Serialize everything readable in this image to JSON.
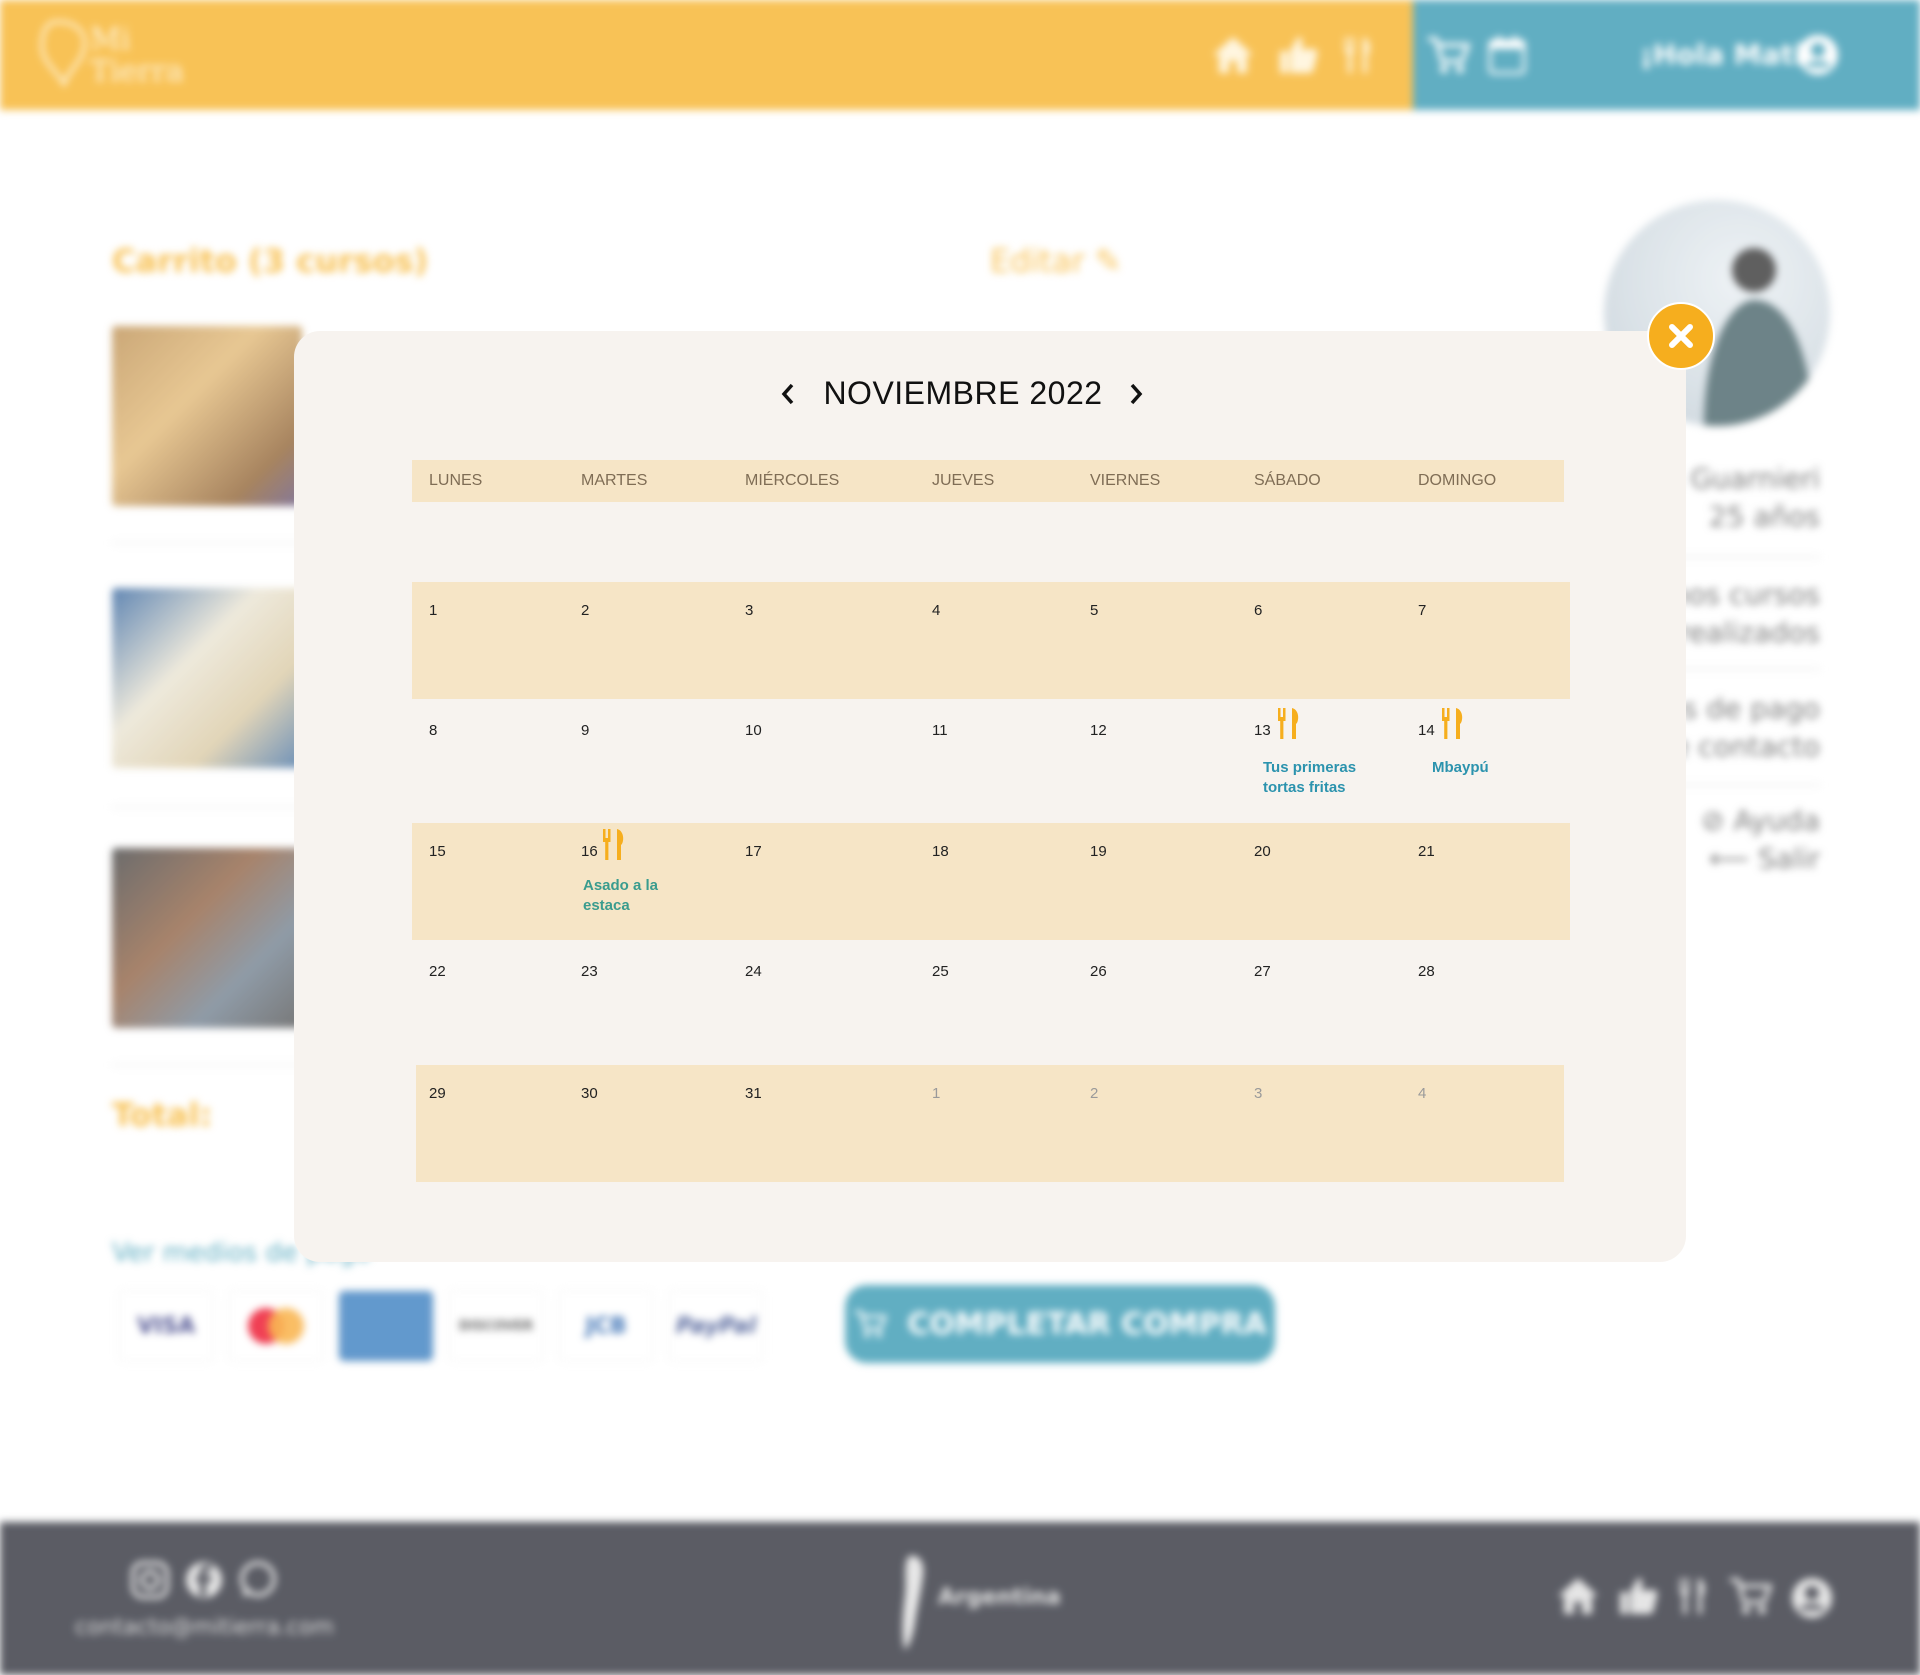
{
  "header": {
    "logo_text": "Mi\nTierra",
    "greeting": "¡Hola Mati!",
    "colors": {
      "yellow": "#F6AE1E",
      "blue": "#2C93AE"
    },
    "nav_icons": [
      "home-icon",
      "thumbs-up-icon",
      "utensils-icon",
      "cart-icon",
      "calendar-icon",
      "user-icon"
    ]
  },
  "cart": {
    "title": "Carrito (3 cursos)",
    "edit_label": "Editar",
    "total_label": "Total:",
    "payment_link": "Ver medios de pago",
    "payment_methods": [
      "VISA",
      "Mastercard",
      "American Express",
      "DISCOVER",
      "JCB",
      "PayPal"
    ],
    "checkout_label": "COMPLETAR COMPRA"
  },
  "sidebar": {
    "name_line": "Matías Guarnieri",
    "age_line": "25 años",
    "courses_line1": "Mis próximos cursos",
    "courses_line2": "Cursos realizados",
    "payment_line1": "Medios de pago",
    "payment_line2": "Datos de contacto",
    "help": "Ayuda",
    "logout": "Salir"
  },
  "footer": {
    "email": "contacto@mitierra.com",
    "country": "Argentina"
  },
  "calendar": {
    "month_label": "NOVIEMBRE 2022",
    "weekdays": [
      "LUNES",
      "MARTES",
      "MIÉRCOLES",
      "JUEVES",
      "VIERNES",
      "SÁBADO",
      "DOMINGO"
    ],
    "weeks": [
      [
        "1",
        "2",
        "3",
        "4",
        "5",
        "6",
        "7"
      ],
      [
        "8",
        "9",
        "10",
        "11",
        "12",
        "13",
        "14"
      ],
      [
        "15",
        "16",
        "17",
        "18",
        "19",
        "20",
        "21"
      ],
      [
        "22",
        "23",
        "24",
        "25",
        "26",
        "27",
        "28"
      ],
      [
        "29",
        "30",
        "31",
        "1",
        "2",
        "3",
        "4"
      ]
    ],
    "events": [
      {
        "day": "13",
        "label_line1": "Tus primeras",
        "label_line2": "tortas fritas",
        "color": "#2C93AE"
      },
      {
        "day": "14",
        "label_line1": "Mbaypú",
        "label_line2": "",
        "color": "#2C93AE"
      },
      {
        "day": "16",
        "label_line1": "Asado a la",
        "label_line2": "estaca",
        "color": "#3A9C8E"
      }
    ],
    "colors": {
      "row_band": "#F6E5C6",
      "modal_bg": "#F7F3EF",
      "event_icon": "#F6AE1E"
    }
  }
}
